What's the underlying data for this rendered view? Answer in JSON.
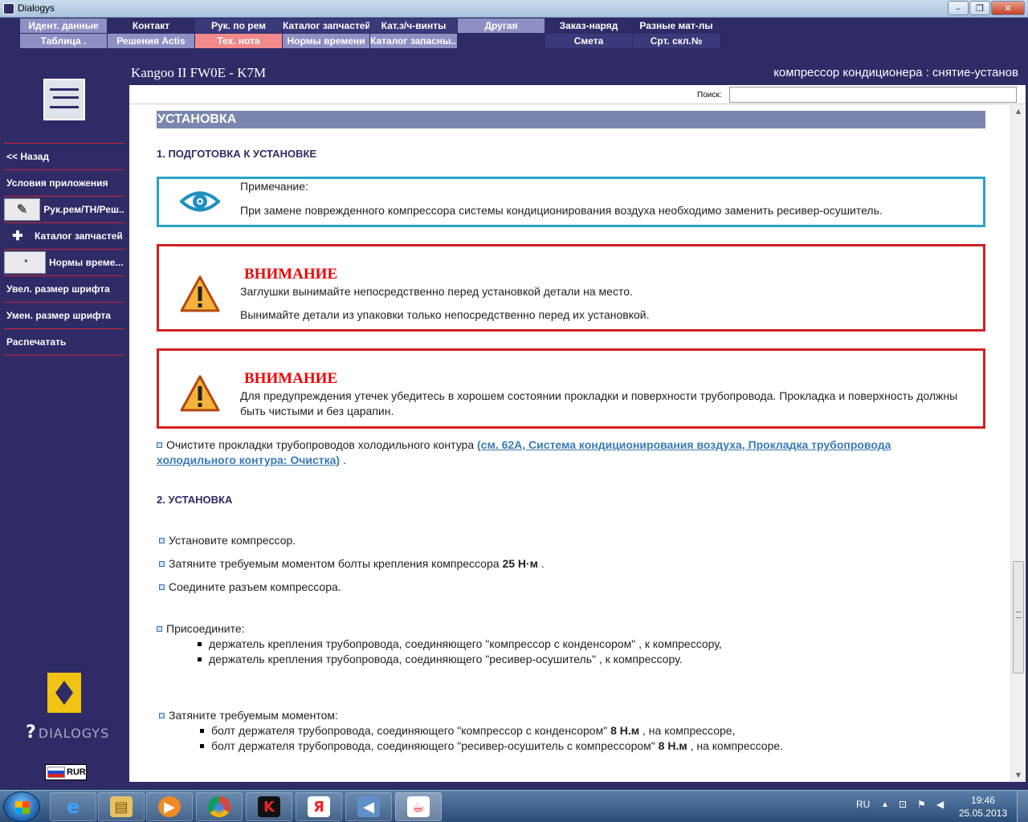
{
  "window": {
    "title": "Dialogys",
    "minimize": "–",
    "restore": "❐",
    "close": "✕"
  },
  "menu": {
    "row1": [
      "Идент. данные",
      "Контакт",
      "Рук. по рем",
      "Каталог запчастей",
      "Кат.з/ч-винты",
      "Другая",
      "Заказ-наряд",
      "Разные мат-лы"
    ],
    "row2": [
      "Таблица .",
      "Решения Actis",
      "Тех. нота",
      "Нормы времени",
      "Каталог запасны...",
      "",
      "Смета",
      "Срт. скл.№"
    ]
  },
  "sidebar": {
    "items": [
      {
        "label": "<< Назад",
        "icon": ""
      },
      {
        "label": "Условия приложения",
        "icon": ""
      },
      {
        "label": "Рук.рем/ТН/Реш....",
        "icon": "wrench-icon"
      },
      {
        "label": "Каталог запчастей",
        "icon": "parts-icon"
      },
      {
        "label": "Нормы време...",
        "icon": "gauge-icon"
      },
      {
        "label": "Увел. размер шрифта",
        "icon": ""
      },
      {
        "label": "Умен. размер шрифта",
        "icon": ""
      },
      {
        "label": "Распечатать",
        "icon": ""
      }
    ],
    "logo_text": "DIALOGYS",
    "logo_mark": "?",
    "currency": "RUR"
  },
  "header": {
    "vehicle": "Kangoo II FW0E - K7M",
    "procedure": "компрессор кондиционера : снятие-установ"
  },
  "search": {
    "label": "Поиск:",
    "value": ""
  },
  "doc": {
    "section_title": "УСТАНОВКА",
    "sub1": "1. ПОДГОТОВКА К УСТАНОВКЕ",
    "note": {
      "title": "Примечание:",
      "text": "При замене поврежденного компрессора системы кондиционирования воздуха необходимо заменить ресивер-осушитель."
    },
    "warning1": {
      "title": "ВНИМАНИЕ",
      "line1": "Заглушки вынимайте непосредственно перед установкой детали на место.",
      "line2": "Вынимайте детали из упаковки только непосредственно перед их установкой."
    },
    "warning2": {
      "title": "ВНИМАНИЕ",
      "text": "Для предупреждения утечек убедитесь в хорошем состоянии прокладки и поверхности трубопровода. Прокладка и поверхность должны быть чистыми и без царапин."
    },
    "clean": {
      "text": "Очистите прокладки трубопроводов холодильного контура ",
      "link": "(см. 62A, Система кондиционирования воздуха, Прокладка трубопровода холодильного контура: Очистка)",
      "end": " ."
    },
    "sub2": "2. УСТАНОВКА",
    "step1": "Установите компрессор.",
    "step2_a": "Затяните требуемым моментом болты крепления компрессора ",
    "step2_b": "25 Н·м",
    "step2_c": " .",
    "step3": "Соедините разъем компрессора.",
    "attach": "Присоедините:",
    "attach_1": "держатель крепления трубопровода, соединяющего \"компрессор с конденсором\" , к компрессору,",
    "attach_2": "держатель крепления трубопровода, соединяющего \"ресивер-осушитель\" , к компрессору.",
    "torque": "Затяните требуемым моментом:",
    "torque_1a": "болт держателя трубопровода, соединяющего \"компрессор с конденсором\" ",
    "torque_1b": "8 Н.м",
    "torque_1c": " , на компрессоре,",
    "torque_2a": "болт держателя трубопровода, соединяющего \"ресивер-осушитель с компрессором\" ",
    "torque_2b": "8 Н.м",
    "torque_2c": " , на компрессоре."
  },
  "taskbar": {
    "apps": [
      "ie-icon",
      "explorer-icon",
      "media-player-icon",
      "chrome-icon",
      "kaspersky-icon",
      "yandex-icon",
      "speaker-icon",
      "java-icon"
    ],
    "app_glyphs": [
      "e",
      "▤",
      "▶",
      "◉",
      "K",
      "Я",
      "◀",
      "☕"
    ],
    "lang": "RU",
    "time": "19:46",
    "date": "25.05.2013"
  },
  "colors": {
    "background": "#2e2b66",
    "menu_light": "#8f8fc3",
    "menu_active": "#f28a8c",
    "section_bar": "#7a86ad",
    "note_border": "#2aa4c8",
    "warning_border": "#d42020",
    "link": "#3a7ab5"
  }
}
